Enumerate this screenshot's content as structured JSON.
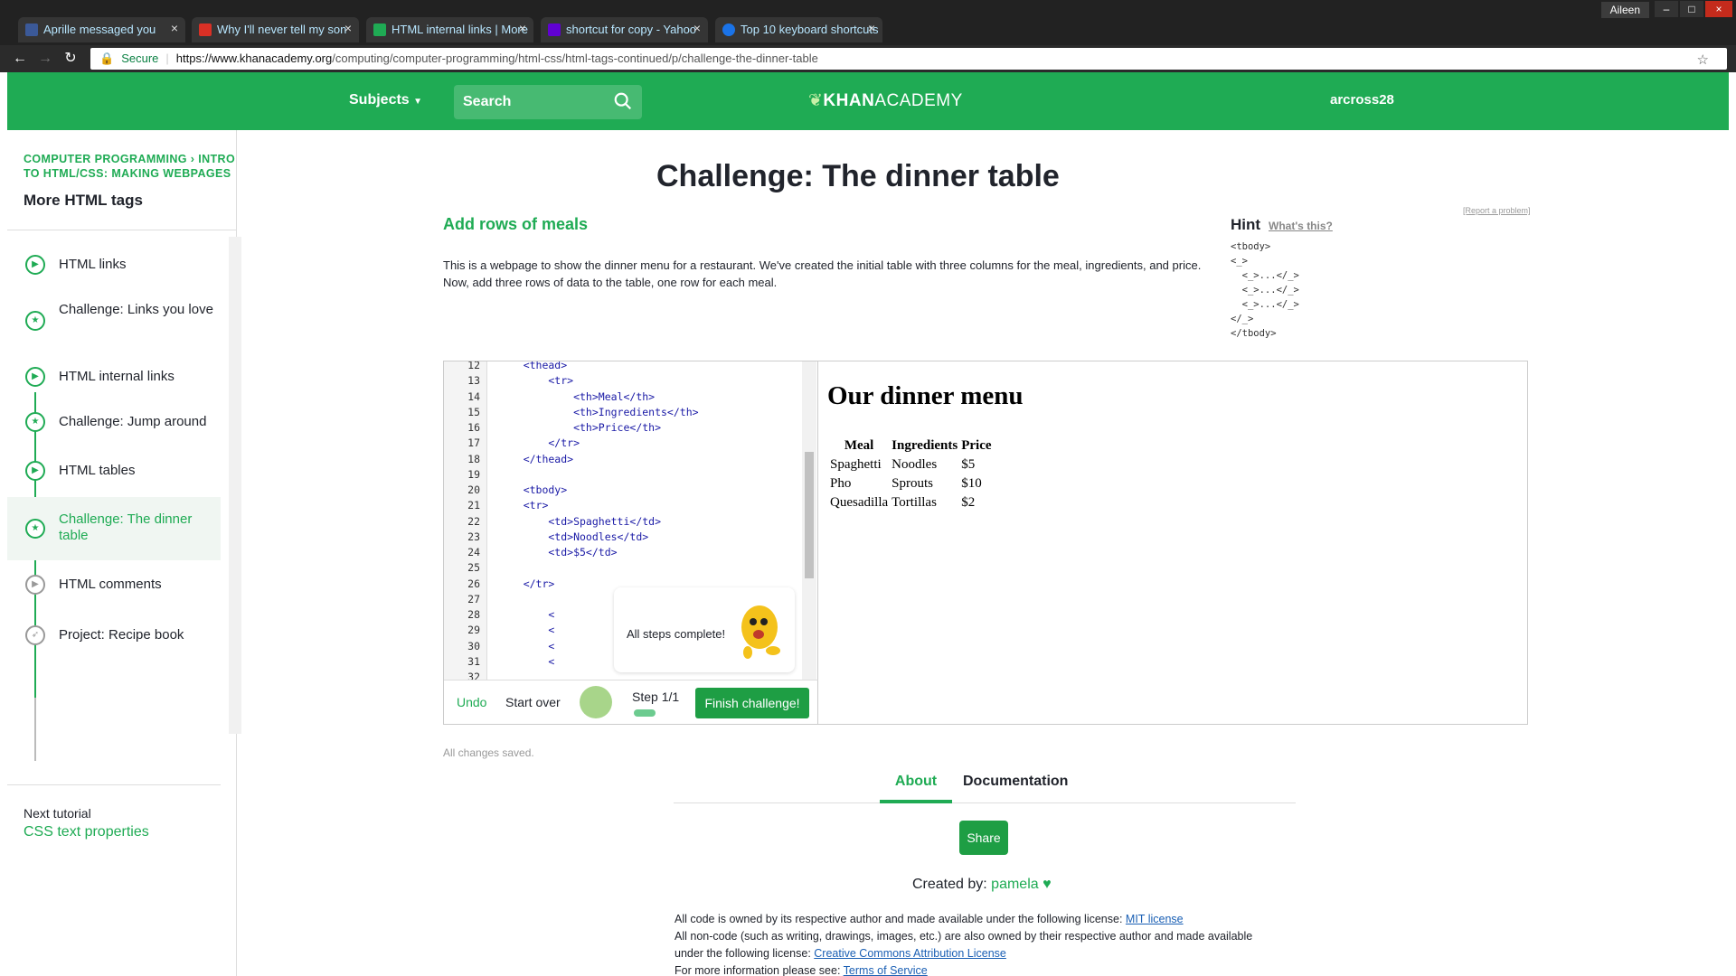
{
  "browser": {
    "tabs": [
      {
        "label": "Aprille messaged you",
        "favicon_color": "#3b5998"
      },
      {
        "label": "Why I'll never tell my son",
        "favicon_color": "#d93025"
      },
      {
        "label": "HTML internal links | More",
        "favicon_color": "#1fab54"
      },
      {
        "label": "shortcut for copy - Yahoo",
        "favicon_color": "#6001d2"
      },
      {
        "label": "Top 10 keyboard shortcuts",
        "favicon_color": "#1a73e8"
      }
    ],
    "user_chip": "Aileen",
    "secure_label": "Secure",
    "url_host": "https://www.khanacademy.org",
    "url_path": "/computing/computer-programming/html-css/html-tags-continued/p/challenge-the-dinner-table"
  },
  "header": {
    "subjects": "Subjects",
    "search_placeholder": "Search",
    "logo_bold": "KHAN",
    "logo_light": "ACADEMY",
    "username": "arcross28",
    "brand_color": "#1fab54"
  },
  "sidebar": {
    "breadcrumb": "COMPUTER PROGRAMMING  ›  INTRO TO HTML/CSS: MAKING WEBPAGES",
    "title": "More HTML tags",
    "lessons": [
      {
        "label": "HTML links",
        "icon": "play-icon"
      },
      {
        "label": "Challenge: Links you love",
        "icon": "star-icon"
      },
      {
        "label": "HTML internal links",
        "icon": "play-icon"
      },
      {
        "label": "Challenge: Jump around",
        "icon": "star-icon"
      },
      {
        "label": "HTML tables",
        "icon": "play-icon"
      },
      {
        "label": "Challenge: The dinner table",
        "icon": "star-icon"
      },
      {
        "label": "HTML comments",
        "icon": "play-icon"
      },
      {
        "label": "Project: Recipe book",
        "icon": "rocket-icon"
      }
    ],
    "next_label": "Next tutorial",
    "next_link": "CSS text properties"
  },
  "main": {
    "title": "Challenge: The dinner table",
    "report": "[Report a problem]",
    "challenge_heading": "Add rows of meals",
    "challenge_desc": "This is a webpage to show the dinner menu for a restaurant. We've created the initial table with three columns for the meal, ingredients, and price. Now, add three rows of data to the table, one row for each meal.",
    "hint_title": "Hint",
    "hint_whats": "What's this?",
    "hint_code": "<tbody>\n<_>\n  <_>...</_>\n  <_>...</_>\n  <_>...</_>\n</_>\n</tbody>"
  },
  "editor": {
    "line_numbers": [
      "12",
      "13",
      "14",
      "15",
      "16",
      "17",
      "18",
      "19",
      "20",
      "21",
      "22",
      "23",
      "24",
      "25",
      "26",
      "27",
      "28",
      "29",
      "30",
      "31",
      "32"
    ],
    "lines": [
      "    <thead>",
      "        <tr>",
      "            <th>Meal</th>",
      "            <th>Ingredients</th>",
      "            <th>Price</th>",
      "        </tr>",
      "    </thead>",
      "",
      "    <tbody>",
      "    <tr>",
      "        <td>Spaghetti</td>",
      "        <td>Noodles</td>",
      "        <td>$5</td>",
      "",
      "    </tr>",
      "",
      "        <",
      "        <",
      "        <",
      "        <",
      ""
    ],
    "bubble_text": "All steps complete!",
    "undo": "Undo",
    "start_over": "Start over",
    "step": "Step 1/1",
    "finish": "Finish challenge!"
  },
  "output": {
    "title": "Our dinner menu",
    "headers": [
      "Meal",
      "Ingredients",
      "Price"
    ],
    "rows": [
      [
        "Spaghetti",
        "Noodles",
        "$5"
      ],
      [
        "Pho",
        "Sprouts",
        "$10"
      ],
      [
        "Quesadilla",
        "Tortillas",
        "$2"
      ]
    ]
  },
  "footer": {
    "saved": "All changes saved.",
    "tab_about": "About",
    "tab_docs": "Documentation",
    "share": "Share",
    "created_by_label": "Created by:",
    "author": "pamela",
    "license_line1_text": "All code is owned by its respective author and made available under the following license:",
    "license_line1_link": "MIT license",
    "license_line2_text": "All non-code (such as writing, drawings, images, etc.) are also owned by their respective author and made available under the following license:",
    "license_line2_link": "Creative Commons Attribution License",
    "license_line3_text": "For more information please see:",
    "license_line3_link": "Terms of Service"
  }
}
